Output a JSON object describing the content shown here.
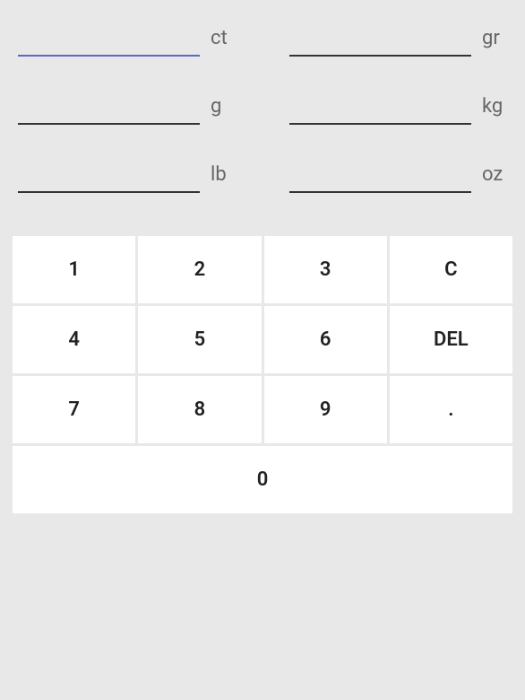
{
  "fields": [
    {
      "unit": "ct",
      "value": "",
      "active": true
    },
    {
      "unit": "gr",
      "value": "",
      "active": false
    },
    {
      "unit": "g",
      "value": "",
      "active": false
    },
    {
      "unit": "kg",
      "value": "",
      "active": false
    },
    {
      "unit": "lb",
      "value": "",
      "active": false
    },
    {
      "unit": "oz",
      "value": "",
      "active": false
    }
  ],
  "keypad": {
    "rows": [
      [
        "1",
        "2",
        "3",
        "C"
      ],
      [
        "4",
        "5",
        "6",
        "DEL"
      ],
      [
        "7",
        "8",
        "9",
        "."
      ]
    ],
    "zero": "0"
  }
}
